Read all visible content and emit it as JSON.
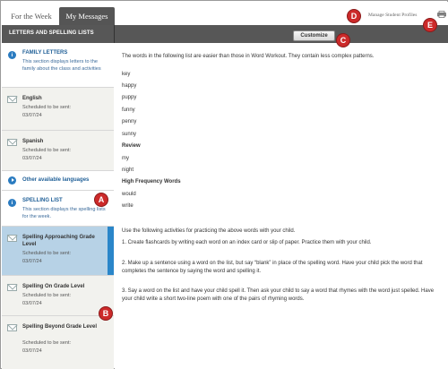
{
  "tabs": {
    "for_the_week": "For the Week",
    "my_messages": "My Messages"
  },
  "header": {
    "manage_profiles": "Manage Student Profiles",
    "print_icon": "print-icon"
  },
  "sidebar": {
    "title": "LETTERS AND SPELLING LISTS",
    "family": {
      "title": "FAMILY LETTERS",
      "desc": "This section displays letters to the family about the class and activities"
    },
    "english": {
      "name": "English",
      "sched_label": "Scheduled to be sent:",
      "date": "03/07/24"
    },
    "spanish": {
      "name": "Spanish",
      "sched_label": "Scheduled to be sent:",
      "date": "03/07/24"
    },
    "other_languages": "Other available languages",
    "spelling": {
      "title": "SPELLING LIST",
      "desc": "This section displays the spelling lists for the week."
    },
    "approaching": {
      "name": "Spelling Approaching Grade Level",
      "sched_label": "Scheduled to be sent:",
      "date": "03/07/24"
    },
    "on_grade": {
      "name": "Spelling On Grade Level",
      "sched_label": "Scheduled to be sent:",
      "date": "03/07/24"
    },
    "beyond": {
      "name": "Spelling Beyond Grade Level",
      "sched_label": "Scheduled to be sent:",
      "date": "03/07/24"
    }
  },
  "toolbar": {
    "customize": "Customize"
  },
  "content": {
    "intro": "The words in the following list are easier than those in Word Workout. They contain less complex patterns.",
    "words": [
      "key",
      "happy",
      "puppy",
      "funny",
      "penny",
      "sunny"
    ],
    "review_heading": "Review",
    "review_words": [
      "my",
      "night"
    ],
    "hf_heading": "High Frequency Words",
    "hf_words": [
      "would",
      "write"
    ],
    "activities_intro": "Use the following activities for practicing the above words with your child.",
    "activity1": "1.   Create flashcards by writing each word on an index card or slip of paper. Practice them with your child.",
    "activity2": "2.   Make up a sentence using a word on the list, but say “blank” in place of the spelling word. Have your child pick the word that completes the sentence by saying the word and spelling it.",
    "activity3": "3.   Say a word on the list and have your child spell it. Then ask your child to say a word that rhymes with the word just spelled. Have your child write a short two-line poem with one of the pairs of rhyming words."
  },
  "callouts": {
    "a": "A",
    "b": "B",
    "c": "C",
    "d": "D",
    "e": "E"
  },
  "colors": {
    "accent": "#2a86c9",
    "header_bar": "#575757",
    "callout": "#cc2a2a",
    "selected": "#b7d2e6"
  }
}
